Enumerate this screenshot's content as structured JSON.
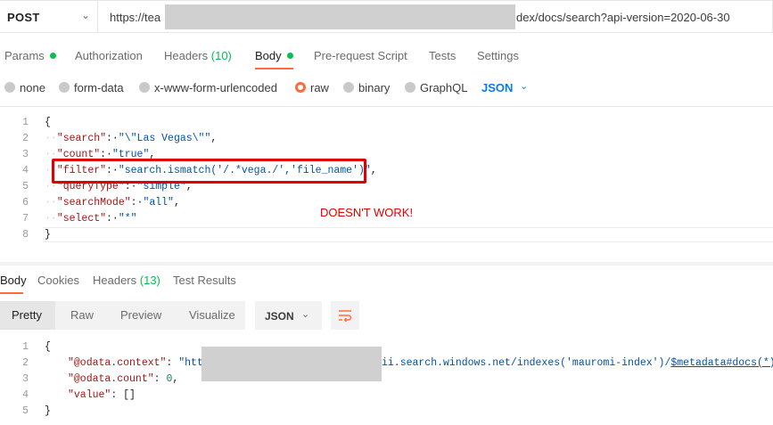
{
  "request": {
    "method": "POST",
    "url_start": "https://tea",
    "url_end": "dex/docs/search?api-version=2020-06-30"
  },
  "request_tabs": {
    "params": "Params",
    "authorization": "Authorization",
    "headers": "Headers",
    "headers_count": "(10)",
    "body": "Body",
    "prerequest": "Pre-request Script",
    "tests": "Tests",
    "settings": "Settings"
  },
  "body_types": {
    "none": "none",
    "form_data": "form-data",
    "urlencoded": "x-www-form-urlencoded",
    "raw": "raw",
    "binary": "binary",
    "graphql": "GraphQL",
    "format": "JSON",
    "selected": "raw"
  },
  "request_body": {
    "line_numbers": [
      "1",
      "2",
      "3",
      "4",
      "5",
      "6",
      "7",
      "8"
    ],
    "open": "{",
    "close": "}",
    "search_key": "\"search\"",
    "search_val": "\"\\\"Las Vegas\\\"\"",
    "count_key": "\"count\"",
    "count_val": "\"true\"",
    "filter_key": "\"filter\"",
    "filter_val": "\"search.ismatch('/.*vega./','file_name')\"",
    "querytype_key": "\"queryType\"",
    "querytype_val": "\"simple\"",
    "searchmode_key": "\"searchMode\"",
    "searchmode_val": "\"all\"",
    "select_key": "\"select\"",
    "select_val": "\"*\""
  },
  "annotation": "DOESN'T WORK!",
  "response_tabs": {
    "body": "Body",
    "cookies": "Cookies",
    "headers": "Headers",
    "headers_count": "(13)",
    "test_results": "Test Results"
  },
  "response_view": {
    "pretty": "Pretty",
    "raw": "Raw",
    "preview": "Preview",
    "visualize": "Visualize",
    "format": "JSON"
  },
  "response_body": {
    "line_numbers": [
      "1",
      "2",
      "3",
      "4",
      "5"
    ],
    "open": "{",
    "close": "}",
    "context_key": "\"@odata.context\"",
    "context_val_start": "\"http",
    "context_val_end_a": "ii.search.windows.net/indexes('mauromi-index')/",
    "context_val_link": "$metadata#docs(*)",
    "context_val_end_b": "\",",
    "count_key": "\"@odata.count\"",
    "count_val": "0",
    "value_key": "\"value\"",
    "value_val": "[]"
  },
  "colors": {
    "accent": "#ff6c37",
    "active_dot": "#0cbb52",
    "link_blue": "#097bed",
    "annotation_red": "#e00000"
  }
}
